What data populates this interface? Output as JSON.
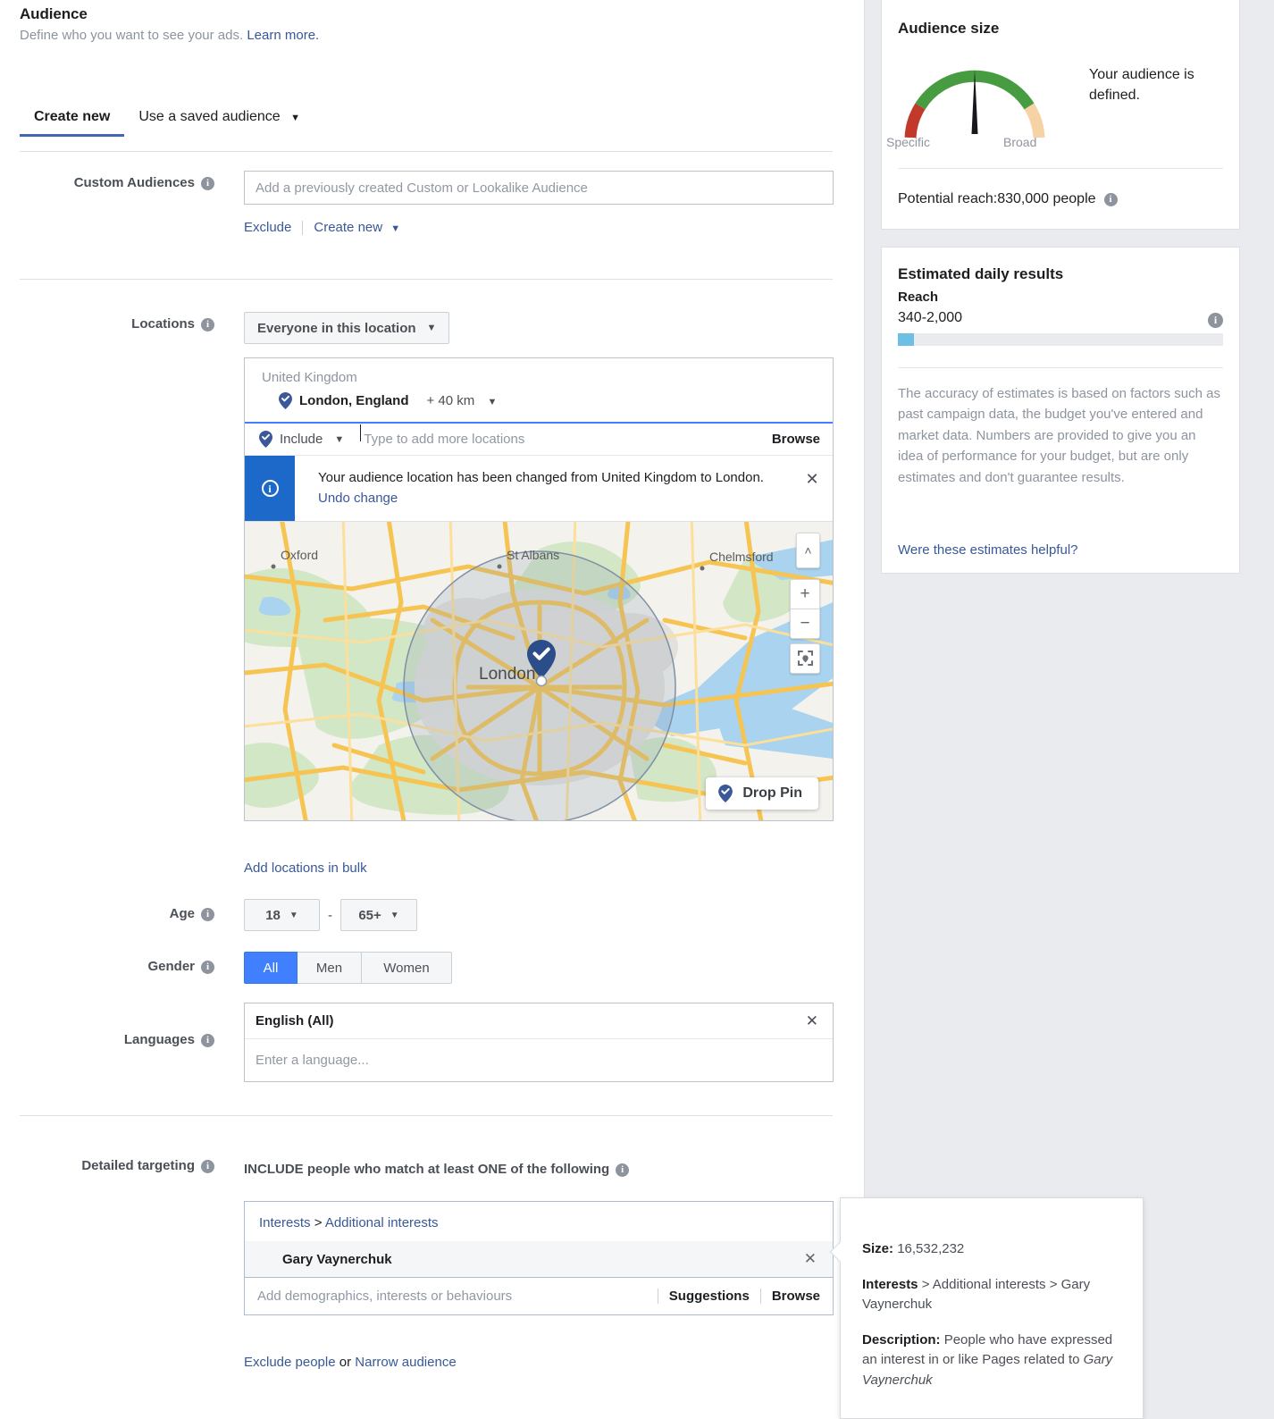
{
  "header": {
    "title": "Audience",
    "subtitle": "Define who you want to see your ads.",
    "learn_more": "Learn more."
  },
  "tabs": [
    {
      "label": "Create new",
      "active": true
    },
    {
      "label": "Use a saved audience",
      "active": false,
      "caret": "▼"
    }
  ],
  "custom_audiences": {
    "label": "Custom Audiences",
    "placeholder": "Add a previously created Custom or Lookalike Audience",
    "value": "",
    "exclude_label": "Exclude",
    "create_new_label": "Create new",
    "create_new_caret": "▼"
  },
  "locations": {
    "label": "Locations",
    "scope_select": "Everyone in this location",
    "scope_caret": "▼",
    "country": "United Kingdom",
    "selected_location": "London, England",
    "radius": "+ 40 km",
    "radius_caret": "▼",
    "include_label": "Include",
    "include_caret": "▼",
    "type_placeholder": "Type to add more locations",
    "browse_label": "Browse",
    "notice_text": "Your audience location has been changed from United Kingdom to London.",
    "notice_link": "Undo change",
    "notice_close": "✕",
    "bulk_link": "Add locations in bulk",
    "drop_pin_label": "Drop Pin",
    "map": {
      "city_label": "London",
      "towns": [
        "Oxford",
        "St Albans",
        "Chelmsford"
      ],
      "controls": {
        "compass": "˄",
        "zoom_in": "+",
        "zoom_out": "−",
        "recenter": "recenter-icon"
      }
    }
  },
  "age": {
    "label": "Age",
    "min": "18",
    "max": "65+",
    "dash": "-",
    "caret": "▼"
  },
  "gender": {
    "label": "Gender",
    "options": [
      "All",
      "Men",
      "Women"
    ],
    "selected": "All"
  },
  "languages": {
    "label": "Languages",
    "selected": "English (All)",
    "remove": "✕",
    "placeholder": "Enter a language..."
  },
  "detailed_targeting": {
    "label": "Detailed targeting",
    "heading": "INCLUDE people who match at least ONE of the following",
    "breadcrumb_first": "Interests",
    "breadcrumb_sep": " > ",
    "breadcrumb_second": "Additional interests",
    "chip": "Gary Vaynerchuk",
    "chip_remove": "✕",
    "placeholder": "Add demographics, interests or behaviours",
    "suggestions_label": "Suggestions",
    "browse_label": "Browse",
    "exclude_link": "Exclude people",
    "or_text": " or ",
    "narrow_link": "Narrow audience"
  },
  "audience_size": {
    "title": "Audience size",
    "gauge_left_label": "Specific",
    "gauge_right_label": "Broad",
    "status": "Your audience is defined.",
    "reach_label": "Potential reach:",
    "reach_value": "830,000 people",
    "colors": {
      "red": "#c0392b",
      "green": "#479b40",
      "peach": "#f6d2a4",
      "needle": "#16181c"
    }
  },
  "estimated_results": {
    "title": "Estimated daily results",
    "metric": "Reach",
    "value": "340-2,000",
    "bar_fill_percent": 5,
    "bar_fill_color": "#6cc0e5",
    "body": "The accuracy of estimates is based on factors such as past campaign data, the budget you've entered and market data. Numbers are provided to give you an idea of performance for your budget, but are only estimates and don't guarantee results.",
    "feedback_link": "Were these estimates helpful?"
  },
  "tooltip": {
    "size_label": "Size:",
    "size_value": "16,532,232",
    "path_label": "Interests",
    "path_rest": " > Additional interests > Gary Vaynerchuk",
    "description_label": "Description:",
    "description_text": "People who have expressed an interest in or like Pages related to ",
    "description_italic": "Gary Vaynerchuk"
  }
}
